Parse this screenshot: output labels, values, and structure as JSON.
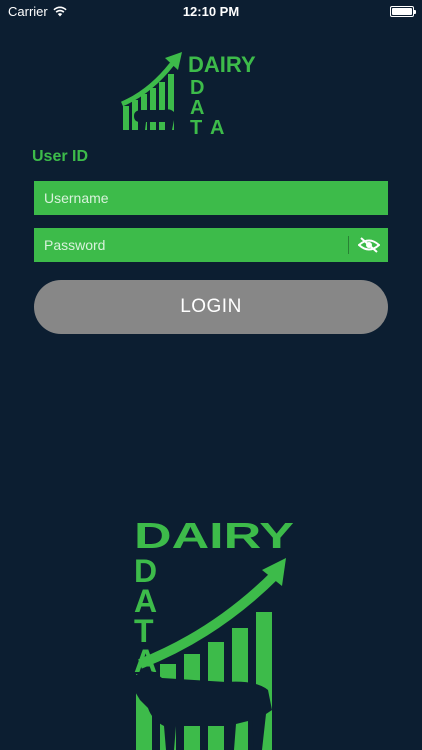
{
  "status_bar": {
    "carrier": "Carrier",
    "time": "12:10 PM",
    "wifi_icon": "wifi-icon",
    "battery_icon": "battery-icon"
  },
  "logo": {
    "word1": "DAIRY",
    "word2_letters": [
      "D",
      "A",
      "T",
      "A"
    ],
    "brand_color": "#3dbb4a"
  },
  "form": {
    "section_label": "User ID",
    "username_placeholder": "Username",
    "username_value": "",
    "password_placeholder": "Password",
    "password_value": "",
    "toggle_icon": "eye-slash-icon",
    "login_label": "LOGIN"
  },
  "colors": {
    "background": "#0c1e31",
    "accent": "#3dbb4a",
    "button": "#878787"
  }
}
